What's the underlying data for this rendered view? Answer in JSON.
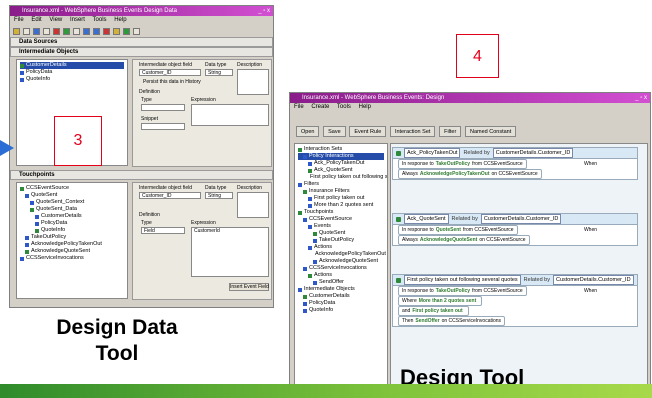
{
  "colors": {
    "accent_red": "#e3001b",
    "title_purple": "#a02aa0",
    "bar_green": "#6db33f",
    "arrow_blue": "#2b6fd6"
  },
  "labels": {
    "callout_left": "3",
    "callout_right": "4",
    "design_data_tool_line1": "Design Data",
    "design_data_tool_line2": "Tool",
    "design_tool": "Design Tool"
  },
  "data_tool": {
    "title": "Insurance.xml - WebSphere Business Events Design Data",
    "window_controls": "_ ▫ x",
    "menu": [
      "File",
      "Edit",
      "View",
      "Insert",
      "Tools",
      "Help"
    ],
    "section_data_sources": "Data Sources",
    "section_intermediate": "Intermediate Objects",
    "section_touchpoints": "Touchpoints",
    "tree_top": [
      {
        "label": "CustomerDetails",
        "selected": true
      },
      {
        "label": "PolicyData",
        "selected": false
      },
      {
        "label": "QuoteInfo",
        "selected": false
      }
    ],
    "form_top": {
      "col1": "Intermediate object field",
      "col2": "Data type",
      "col3": "Description",
      "field1": "Customer_ID",
      "field2": "String",
      "checkbox": "Persist this data in History",
      "definition": "Definition",
      "type": "Type",
      "expression": "Expression",
      "snippet": "Snippet"
    },
    "tree_bottom": [
      {
        "label": "CCSEventSource",
        "indent": 0
      },
      {
        "label": "QuoteSent",
        "indent": 1
      },
      {
        "label": "QuoteSent_Context",
        "indent": 2
      },
      {
        "label": "QuoteSent_Data",
        "indent": 2
      },
      {
        "label": "CustomerDetails",
        "indent": 3
      },
      {
        "label": "PolicyData",
        "indent": 3
      },
      {
        "label": "QuoteInfo",
        "indent": 3
      },
      {
        "label": "TakeOutPolicy",
        "indent": 1
      },
      {
        "label": "AcknowledgePolicyTakenOut",
        "indent": 1
      },
      {
        "label": "AcknowledgeQuoteSent",
        "indent": 1
      },
      {
        "label": "CCSServiceInvocations",
        "indent": 0
      }
    ],
    "form_bottom": {
      "col1": "Intermediate object field",
      "col2": "Data type",
      "col3": "Description",
      "field1": "Customer_ID",
      "field2": "String",
      "definition": "Definition",
      "type": "Type",
      "type_value": "Field",
      "expression": "Expression",
      "expression_value": "CustomerId",
      "button": "Insert Event Field"
    }
  },
  "design_tool": {
    "title": "Insurance.xml - WebSphere Business Events: Design",
    "window_controls": "_ ▫ x",
    "menu": [
      "File",
      "Create",
      "Tools",
      "Help"
    ],
    "toolbar": [
      "Open",
      "Save",
      "Event Rule",
      "Interaction Set",
      "Filter",
      "Named Constant"
    ],
    "tree": [
      {
        "label": "Interaction Sets",
        "indent": 0
      },
      {
        "label": "Policy Interactions",
        "indent": 1,
        "selected": true
      },
      {
        "label": "Ack_PolicyTakenOut",
        "indent": 2
      },
      {
        "label": "Ack_QuoteSent",
        "indent": 2
      },
      {
        "label": "First policy taken out following sev",
        "indent": 2
      },
      {
        "label": "Filters",
        "indent": 0
      },
      {
        "label": "Insurance Filters",
        "indent": 1
      },
      {
        "label": "First policy taken out",
        "indent": 2
      },
      {
        "label": "More than 2 quotes sent",
        "indent": 2
      },
      {
        "label": "Touchpoints",
        "indent": 0
      },
      {
        "label": "CCSEventSource",
        "indent": 1
      },
      {
        "label": "Events",
        "indent": 2
      },
      {
        "label": "QuoteSent",
        "indent": 3
      },
      {
        "label": "TakeOutPolicy",
        "indent": 3
      },
      {
        "label": "Actions",
        "indent": 2
      },
      {
        "label": "AcknowledgePolicyTakenOut",
        "indent": 3
      },
      {
        "label": "AcknowledgeQuoteSent",
        "indent": 3
      },
      {
        "label": "CCSServiceInvocations",
        "indent": 1
      },
      {
        "label": "Actions",
        "indent": 2
      },
      {
        "label": "SendOffer",
        "indent": 3
      },
      {
        "label": "Intermediate Objects",
        "indent": 0
      },
      {
        "label": "CustomerDetails",
        "indent": 1
      },
      {
        "label": "PolicyData",
        "indent": 1
      },
      {
        "label": "QuoteInfo",
        "indent": 1
      }
    ],
    "rules": [
      {
        "name": "Ack_PolicyTakenOut",
        "related": "Related by",
        "key": "CustomerDetails.Customer_ID",
        "lines": [
          {
            "prefix": "In response to",
            "event": "TakeOutPolicy",
            "suffix": "from CCSEventSource",
            "right": "When"
          },
          {
            "prefix": "Always",
            "event": "AcknowledgePolicyTakenOut",
            "suffix": "on CCSEventSource",
            "right": ""
          }
        ]
      },
      {
        "name": "Ack_QuoteSent",
        "related": "Related by",
        "key": "CustomerDetails.Customer_ID",
        "lines": [
          {
            "prefix": "In response to",
            "event": "QuoteSent",
            "suffix": "from CCSEventSource",
            "right": "When"
          },
          {
            "prefix": "Always",
            "event": "AcknowledgeQuoteSent",
            "suffix": "on CCSEventSource",
            "right": ""
          }
        ]
      },
      {
        "name": "First policy taken out following several quotes",
        "related": "Related by",
        "key": "CustomerDetails.Customer_ID",
        "lines": [
          {
            "prefix": "In response to",
            "event": "TakeOutPolicy",
            "suffix": "from CCSEventSource",
            "right": "When"
          },
          {
            "prefix": "Where",
            "event": "More than 2 quotes sent",
            "suffix": "",
            "right": ""
          },
          {
            "prefix": "and",
            "event": "First policy taken out",
            "suffix": "",
            "right": ""
          },
          {
            "prefix": "Then",
            "event": "SendOffer",
            "suffix": "on CCSServiceInvocations",
            "right": ""
          }
        ]
      }
    ]
  }
}
